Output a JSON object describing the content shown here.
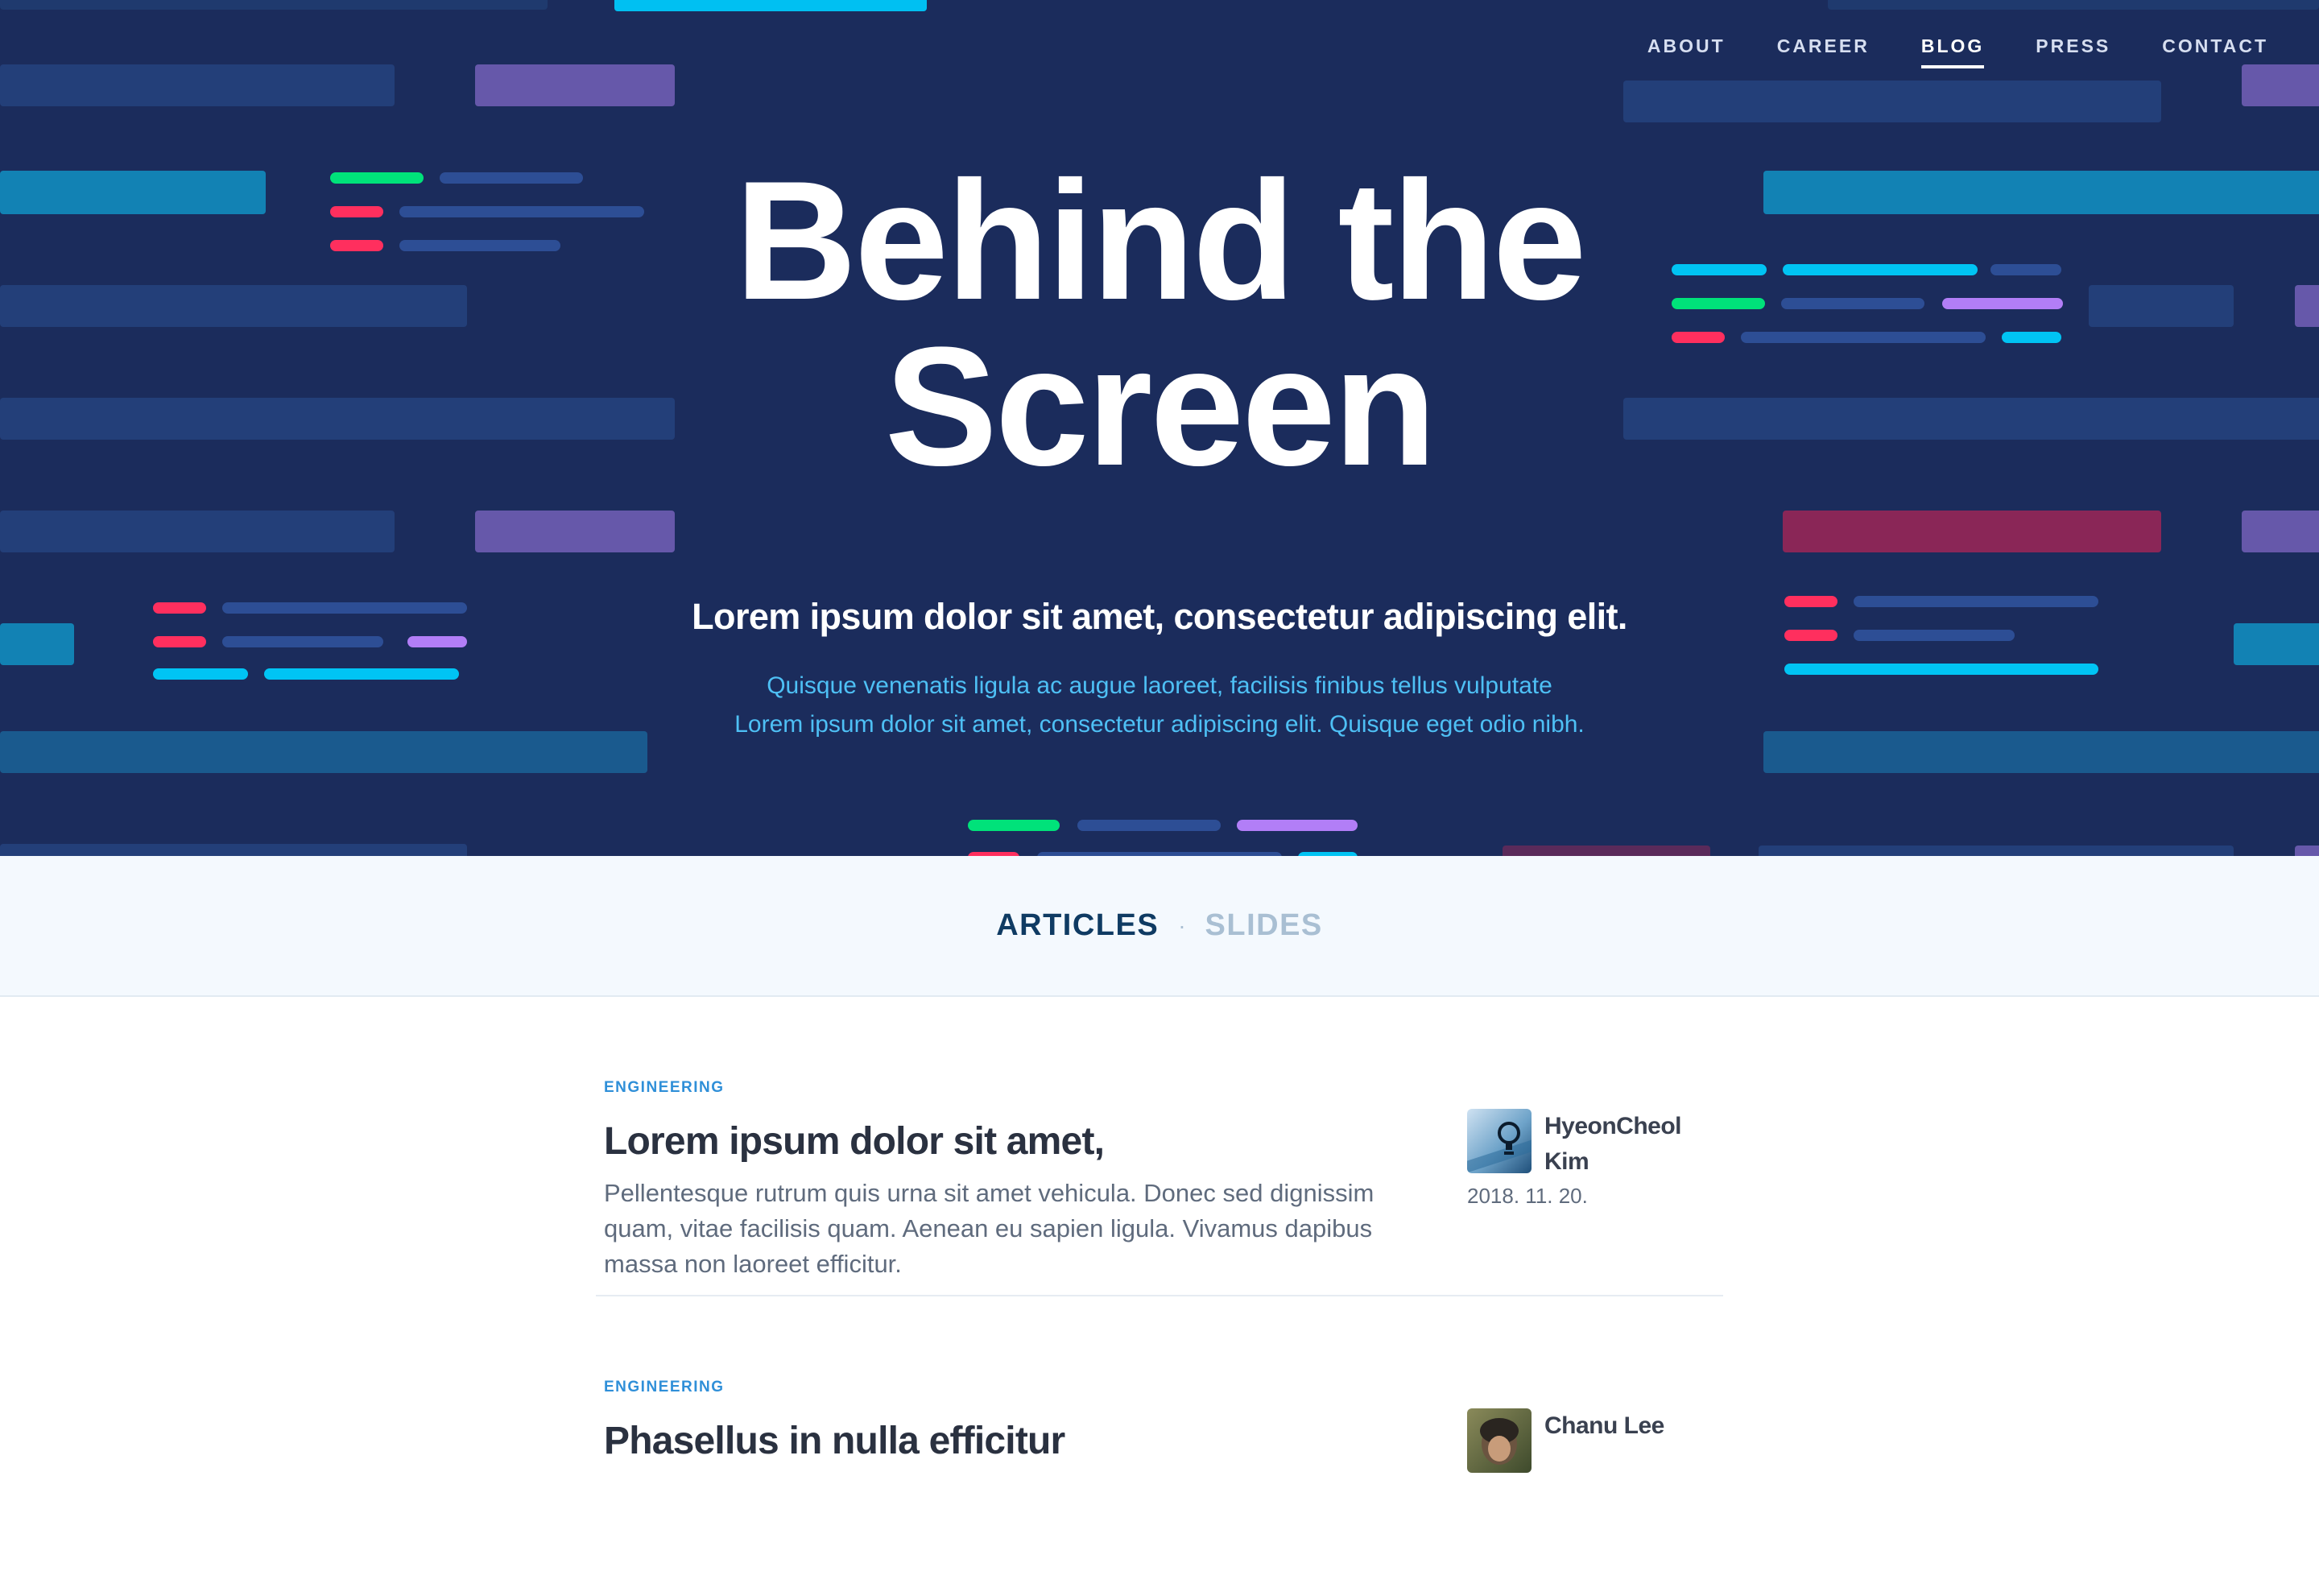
{
  "nav": {
    "items": [
      {
        "label": "ABOUT",
        "active": false
      },
      {
        "label": "CAREER",
        "active": false
      },
      {
        "label": "BLOG",
        "active": true
      },
      {
        "label": "PRESS",
        "active": false
      },
      {
        "label": "CONTACT",
        "active": false
      }
    ]
  },
  "hero": {
    "title_line1": "Behind the",
    "title_line2": "Screen",
    "subtitle": "Lorem ipsum dolor sit amet, consectetur adipiscing elit.",
    "desc_line1": "Quisque venenatis ligula ac augue laoreet, facilisis finibus tellus vulputate",
    "desc_line2": "Lorem ipsum dolor sit amet, consectetur adipiscing elit. Quisque eget odio nibh."
  },
  "tabs": {
    "articles_label": "ARTICLES",
    "separator": "·",
    "slides_label": "SLIDES"
  },
  "articles": [
    {
      "category": "ENGINEERING",
      "title": "Lorem ipsum dolor sit amet,",
      "excerpt": "Pellentesque rutrum quis urna sit amet vehicula. Donec sed dignissim quam, vitae facilisis quam. Aenean eu sapien ligula. Vivamus dapibus massa non laoreet efficitur.",
      "author": "HyeonCheol Kim",
      "date": "2018. 11. 20."
    },
    {
      "category": "ENGINEERING",
      "title": "Phasellus in nulla efficitur",
      "excerpt": "",
      "author": "Chanu Lee",
      "date": ""
    }
  ],
  "colors": {
    "hero_bg": "#1b2c5c",
    "accent_cyan": "#00c4f4",
    "accent_green": "#00e27a",
    "accent_red": "#ff2f5e",
    "accent_purple": "#b27ef7",
    "tab_active": "#0f3b63",
    "tab_inactive": "#a9bfd3",
    "category_blue": "#2f8fd8"
  },
  "icons": {
    "avatar_1": "bulb-keyboard-avatar",
    "avatar_2": "person-photo-avatar"
  }
}
